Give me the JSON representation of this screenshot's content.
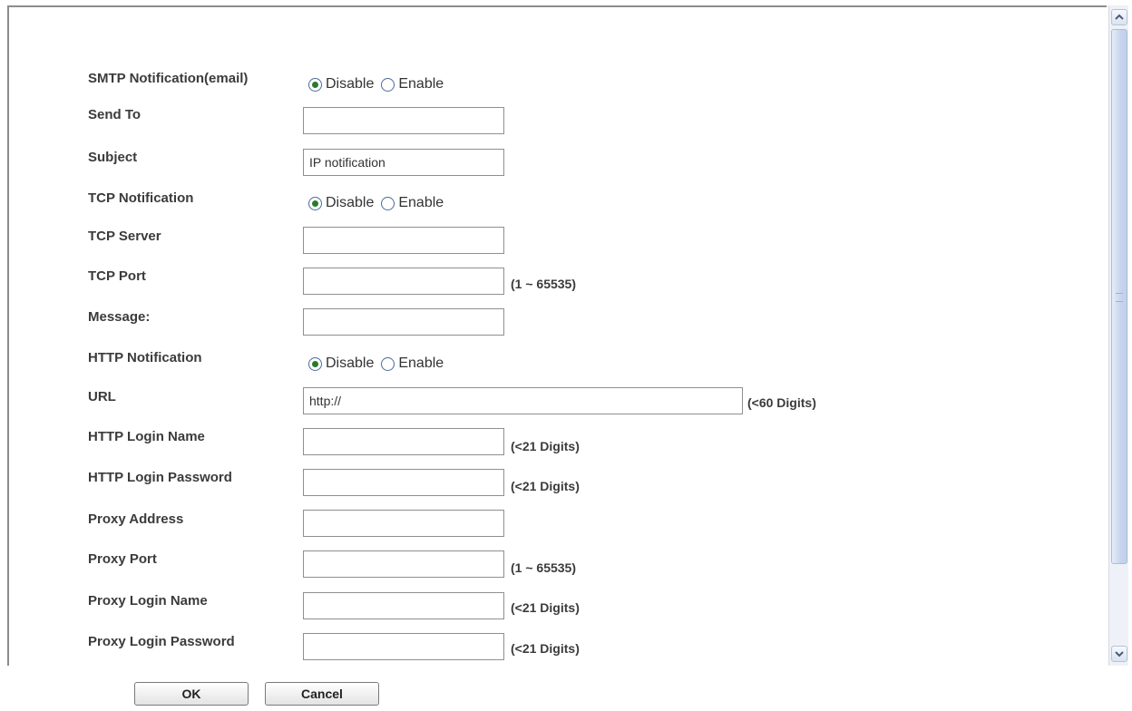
{
  "form": {
    "smtp": {
      "label": "SMTP Notification(email)",
      "disable": "Disable",
      "enable": "Enable"
    },
    "send_to": {
      "label": "Send To",
      "value": ""
    },
    "subject": {
      "label": "Subject",
      "value": "IP notification"
    },
    "tcp": {
      "label": "TCP Notification",
      "disable": "Disable",
      "enable": "Enable"
    },
    "tcp_server": {
      "label": "TCP Server",
      "value": ""
    },
    "tcp_port": {
      "label": "TCP Port",
      "value": "",
      "hint": "(1 ~ 65535)"
    },
    "message": {
      "label": "Message:",
      "value": ""
    },
    "http": {
      "label": "HTTP Notification",
      "disable": "Disable",
      "enable": "Enable"
    },
    "url": {
      "label": "URL",
      "value": "http://",
      "hint": "(<60 Digits)"
    },
    "http_login_name": {
      "label": "HTTP Login Name",
      "value": "",
      "hint": "(<21 Digits)"
    },
    "http_login_password": {
      "label": "HTTP Login Password",
      "value": "",
      "hint": "(<21 Digits)"
    },
    "proxy_address": {
      "label": "Proxy Address",
      "value": ""
    },
    "proxy_port": {
      "label": "Proxy Port",
      "value": "",
      "hint": "(1 ~ 65535)"
    },
    "proxy_login_name": {
      "label": "Proxy Login Name",
      "value": "",
      "hint": "(<21 Digits)"
    },
    "proxy_login_password": {
      "label": "Proxy Login Password",
      "value": "",
      "hint": "(<21 Digits)"
    }
  },
  "buttons": {
    "ok": "OK",
    "cancel": "Cancel"
  },
  "icons": {
    "scroll_up": "chevron-up-icon",
    "scroll_down": "chevron-down-icon"
  },
  "colors": {
    "radio_selected": "#2a7a2a",
    "scrollbar_thumb": "#c7d4ee"
  }
}
